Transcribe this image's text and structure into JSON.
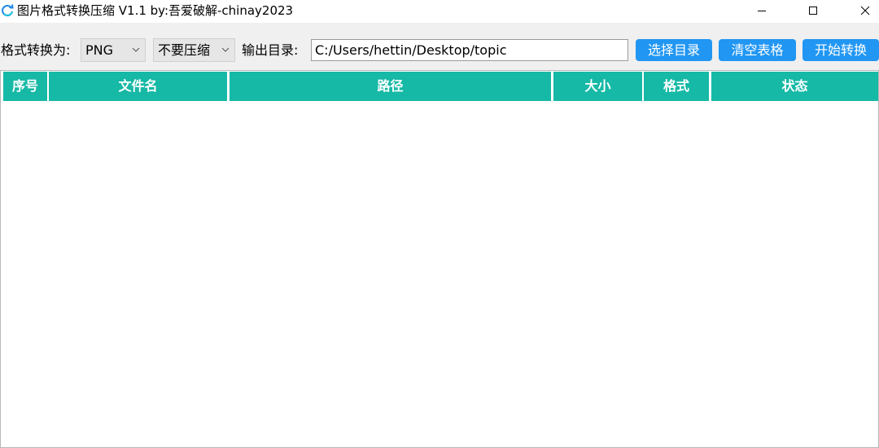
{
  "window": {
    "title": "图片格式转换压缩 V1.1 by:吾爱破解-chinay2023",
    "controls": {
      "minimize": "minimize",
      "maximize": "maximize",
      "close": "close"
    }
  },
  "toolbar": {
    "format_label": "格式转换为:",
    "format_value": "PNG",
    "compress_value": "不要压缩",
    "output_label": "输出目录:",
    "output_path": "C:/Users/hettin/Desktop/topic",
    "select_dir_label": "选择目录",
    "clear_table_label": "清空表格",
    "start_convert_label": "开始转换"
  },
  "table": {
    "columns": [
      "序号",
      "文件名",
      "路径",
      "大小",
      "格式",
      "状态"
    ],
    "rows": []
  },
  "colors": {
    "header_bg": "#16b9a6",
    "button_bg": "#2196f3"
  }
}
